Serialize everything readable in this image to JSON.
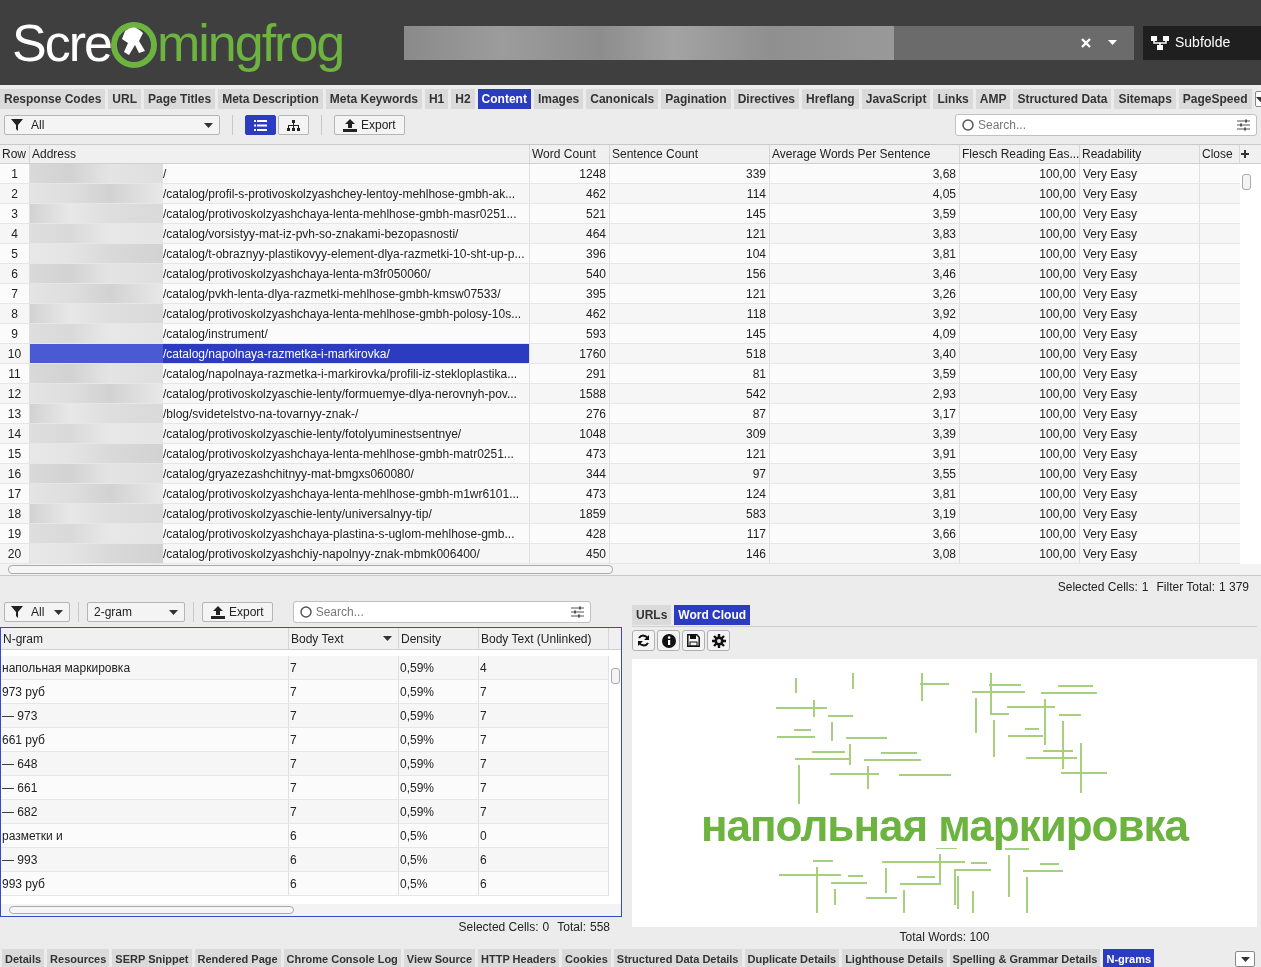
{
  "header": {
    "logo_left": "Scre",
    "logo_right": "mingfrog",
    "mode_button": "Subfolde"
  },
  "tabs": [
    {
      "label": "Response Codes",
      "selected": false
    },
    {
      "label": "URL",
      "selected": false
    },
    {
      "label": "Page Titles",
      "selected": false
    },
    {
      "label": "Meta Description",
      "selected": false
    },
    {
      "label": "Meta Keywords",
      "selected": false
    },
    {
      "label": "H1",
      "selected": false
    },
    {
      "label": "H2",
      "selected": false
    },
    {
      "label": "Content",
      "selected": true
    },
    {
      "label": "Images",
      "selected": false
    },
    {
      "label": "Canonicals",
      "selected": false
    },
    {
      "label": "Pagination",
      "selected": false
    },
    {
      "label": "Directives",
      "selected": false
    },
    {
      "label": "Hreflang",
      "selected": false
    },
    {
      "label": "JavaScript",
      "selected": false
    },
    {
      "label": "Links",
      "selected": false
    },
    {
      "label": "AMP",
      "selected": false
    },
    {
      "label": "Structured Data",
      "selected": false
    },
    {
      "label": "Sitemaps",
      "selected": false
    },
    {
      "label": "PageSpeed",
      "selected": false
    }
  ],
  "toolbar": {
    "filter": "All",
    "view_modes": [
      {
        "kind": "list",
        "selected": true
      },
      {
        "kind": "tree",
        "selected": false
      }
    ],
    "export": "Export",
    "search_placeholder": "Search..."
  },
  "table": {
    "columns": [
      "Row",
      "Address",
      "Word Count",
      "Sentence Count",
      "Average Words Per Sentence",
      "Flesch Reading Eas...",
      "Readability",
      "Close"
    ],
    "rows": [
      {
        "cells": [
          "1",
          "/",
          "1248",
          "339",
          "3,68",
          "100,00",
          "Very Easy"
        ],
        "selected": false
      },
      {
        "cells": [
          "2",
          "/catalog/profil-s-protivoskolzyashchey-lentoy-mehlhose-gmbh-ak...",
          "462",
          "114",
          "4,05",
          "100,00",
          "Very Easy"
        ],
        "selected": false
      },
      {
        "cells": [
          "3",
          "/catalog/protivoskolzyashchaya-lenta-mehlhose-gmbh-masr0251...",
          "521",
          "145",
          "3,59",
          "100,00",
          "Very Easy"
        ],
        "selected": false
      },
      {
        "cells": [
          "4",
          "/catalog/vorsistyy-mat-iz-pvh-so-znakami-bezopasnosti/",
          "464",
          "121",
          "3,83",
          "100,00",
          "Very Easy"
        ],
        "selected": false
      },
      {
        "cells": [
          "5",
          "/catalog/t-obraznyy-plastikovyy-element-dlya-razmetki-10-sht-up-p...",
          "396",
          "104",
          "3,81",
          "100,00",
          "Very Easy"
        ],
        "selected": false
      },
      {
        "cells": [
          "6",
          "/catalog/protivoskolzyashchaya-lenta-m3fr050060/",
          "540",
          "156",
          "3,46",
          "100,00",
          "Very Easy"
        ],
        "selected": false
      },
      {
        "cells": [
          "7",
          "/catalog/pvkh-lenta-dlya-razmetki-mehlhose-gmbh-kmsw07533/",
          "395",
          "121",
          "3,26",
          "100,00",
          "Very Easy"
        ],
        "selected": false
      },
      {
        "cells": [
          "8",
          "/catalog/protivoskolzyashchaya-lenta-mehlhose-gmbh-polosy-10s...",
          "462",
          "118",
          "3,92",
          "100,00",
          "Very Easy"
        ],
        "selected": false
      },
      {
        "cells": [
          "9",
          "/catalog/instrument/",
          "593",
          "145",
          "4,09",
          "100,00",
          "Very Easy"
        ],
        "selected": false
      },
      {
        "cells": [
          "10",
          "/catalog/napolnaya-razmetka-i-markirovka/",
          "1760",
          "518",
          "3,40",
          "100,00",
          "Very Easy"
        ],
        "selected": true
      },
      {
        "cells": [
          "11",
          "/catalog/napolnaya-razmetka-i-markirovka/profili-iz-stekloplastika...",
          "291",
          "81",
          "3,59",
          "100,00",
          "Very Easy"
        ],
        "selected": false
      },
      {
        "cells": [
          "12",
          "/catalog/protivoskolzyaschie-lenty/formuemye-dlya-nerovnyh-pov...",
          "1588",
          "542",
          "2,93",
          "100,00",
          "Very Easy"
        ],
        "selected": false
      },
      {
        "cells": [
          "13",
          "/blog/svidetelstvo-na-tovarnyy-znak-/",
          "276",
          "87",
          "3,17",
          "100,00",
          "Very Easy"
        ],
        "selected": false
      },
      {
        "cells": [
          "14",
          "/catalog/protivoskolzyaschie-lenty/fotolyuminestsentnye/",
          "1048",
          "309",
          "3,39",
          "100,00",
          "Very Easy"
        ],
        "selected": false
      },
      {
        "cells": [
          "15",
          "/catalog/protivoskolzyashchaya-lenta-mehlhose-gmbh-matr0251...",
          "473",
          "121",
          "3,91",
          "100,00",
          "Very Easy"
        ],
        "selected": false
      },
      {
        "cells": [
          "16",
          "/catalog/gryazezashchitnyy-mat-bmgxs060080/",
          "344",
          "97",
          "3,55",
          "100,00",
          "Very Easy"
        ],
        "selected": false
      },
      {
        "cells": [
          "17",
          "/catalog/protivoskolzyashchaya-lenta-mehlhose-gmbh-m1wr6101...",
          "473",
          "124",
          "3,81",
          "100,00",
          "Very Easy"
        ],
        "selected": false
      },
      {
        "cells": [
          "18",
          "/catalog/protivoskolzyaschie-lenty/universalnyy-tip/",
          "1859",
          "583",
          "3,19",
          "100,00",
          "Very Easy"
        ],
        "selected": false
      },
      {
        "cells": [
          "19",
          "/catalog/protivoskolzyashchaya-plastina-s-uglom-mehlhose-gmb...",
          "428",
          "117",
          "3,66",
          "100,00",
          "Very Easy"
        ],
        "selected": false
      },
      {
        "cells": [
          "20",
          "/catalog/protivoskolzyashchiy-napolnyy-znak-mbmk006400/",
          "450",
          "146",
          "3,08",
          "100,00",
          "Very Easy"
        ],
        "selected": false
      }
    ]
  },
  "status": {
    "selected_label": "Selected Cells:",
    "selected": "1",
    "total_label": "Filter Total:",
    "total": "1 379"
  },
  "ngrams": {
    "filter": "All",
    "gram": "2-gram",
    "export": "Export",
    "search_placeholder": "Search...",
    "columns": [
      "N-gram",
      "Body Text",
      "Density",
      "Body Text (Unlinked)"
    ],
    "rows": [
      [
        "напольная маркировка",
        "7",
        "0,59%",
        "4"
      ],
      [
        "973 руб",
        "7",
        "0,59%",
        "7"
      ],
      [
        "— 973",
        "7",
        "0,59%",
        "7"
      ],
      [
        "661 руб",
        "7",
        "0,59%",
        "7"
      ],
      [
        "— 648",
        "7",
        "0,59%",
        "7"
      ],
      [
        "— 661",
        "7",
        "0,59%",
        "7"
      ],
      [
        "— 682",
        "7",
        "0,59%",
        "7"
      ],
      [
        "разметки и",
        "6",
        "0,5%",
        "0"
      ],
      [
        "— 993",
        "6",
        "0,5%",
        "6"
      ],
      [
        "993 руб",
        "6",
        "0,5%",
        "6"
      ]
    ],
    "status": {
      "selected_label": "Selected Cells:",
      "selected": "0",
      "total_label": "Total:",
      "total": "558"
    }
  },
  "side_tabs": [
    {
      "label": "URLs",
      "selected": false
    },
    {
      "label": "Word Cloud",
      "selected": true
    }
  ],
  "word_cloud": {
    "main_word": "напольная маркировка",
    "total": "Total Words: 100"
  },
  "bottom_tabs": [
    {
      "label": "Details",
      "selected": false
    },
    {
      "label": "Resources",
      "selected": false
    },
    {
      "label": "SERP Snippet",
      "selected": false
    },
    {
      "label": "Rendered Page",
      "selected": false
    },
    {
      "label": "Chrome Console Log",
      "selected": false
    },
    {
      "label": "View Source",
      "selected": false
    },
    {
      "label": "HTTP Headers",
      "selected": false
    },
    {
      "label": "Cookies",
      "selected": false
    },
    {
      "label": "Structured Data Details",
      "selected": false
    },
    {
      "label": "Duplicate Details",
      "selected": false
    },
    {
      "label": "Lighthouse Details",
      "selected": false
    },
    {
      "label": "Spelling & Grammar Details",
      "selected": false
    },
    {
      "label": "N-grams",
      "selected": true
    }
  ]
}
